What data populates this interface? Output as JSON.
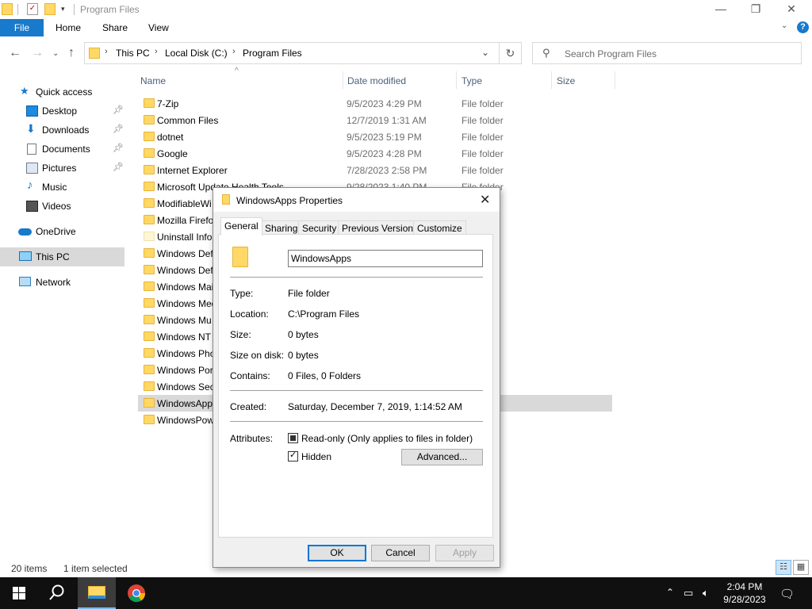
{
  "window": {
    "title": "Program Files",
    "minimize": "—",
    "maximize": "❐",
    "close": "✕"
  },
  "ribbon": {
    "file": "File",
    "tabs": [
      "Home",
      "Share",
      "View"
    ],
    "help": "?"
  },
  "address": {
    "crumbs": [
      "This PC",
      "Local Disk (C:)",
      "Program Files"
    ],
    "search_placeholder": "Search Program Files"
  },
  "nav": {
    "quick_access": "Quick access",
    "desktop": "Desktop",
    "downloads": "Downloads",
    "documents": "Documents",
    "pictures": "Pictures",
    "music": "Music",
    "videos": "Videos",
    "onedrive": "OneDrive",
    "this_pc": "This PC",
    "network": "Network"
  },
  "columns": {
    "name": "Name",
    "date": "Date modified",
    "type": "Type",
    "size": "Size"
  },
  "files": [
    {
      "name": "7-Zip",
      "date": "9/5/2023 4:29 PM",
      "type": "File folder"
    },
    {
      "name": "Common Files",
      "date": "12/7/2019 1:31 AM",
      "type": "File folder"
    },
    {
      "name": "dotnet",
      "date": "9/5/2023 5:19 PM",
      "type": "File folder"
    },
    {
      "name": "Google",
      "date": "9/5/2023 4:28 PM",
      "type": "File folder"
    },
    {
      "name": "Internet Explorer",
      "date": "7/28/2023 2:58 PM",
      "type": "File folder"
    },
    {
      "name": "Microsoft Update Health Tools",
      "date": "9/28/2023 1:40 PM",
      "type": "File folder"
    },
    {
      "name": "ModifiableWi",
      "date": "",
      "type": ""
    },
    {
      "name": "Mozilla Firefo",
      "date": "",
      "type": ""
    },
    {
      "name": "Uninstall Info",
      "date": "",
      "type": ""
    },
    {
      "name": "Windows Def",
      "date": "",
      "type": ""
    },
    {
      "name": "Windows Def",
      "date": "",
      "type": ""
    },
    {
      "name": "Windows Mai",
      "date": "",
      "type": ""
    },
    {
      "name": "Windows Med",
      "date": "",
      "type": ""
    },
    {
      "name": "Windows Mu",
      "date": "",
      "type": ""
    },
    {
      "name": "Windows NT",
      "date": "",
      "type": ""
    },
    {
      "name": "Windows Pho",
      "date": "",
      "type": ""
    },
    {
      "name": "Windows Por",
      "date": "",
      "type": ""
    },
    {
      "name": "Windows Sec",
      "date": "",
      "type": ""
    },
    {
      "name": "WindowsApp",
      "date": "",
      "type": ""
    },
    {
      "name": "WindowsPow",
      "date": "",
      "type": ""
    }
  ],
  "status": {
    "count": "20 items",
    "selected": "1 item selected"
  },
  "dialog": {
    "title": "WindowsApps Properties",
    "tabs": [
      "General",
      "Sharing",
      "Security",
      "Previous Versions",
      "Customize"
    ],
    "folder_name": "WindowsApps",
    "type_label": "Type:",
    "type_value": "File folder",
    "location_label": "Location:",
    "location_value": "C:\\Program Files",
    "size_label": "Size:",
    "size_value": "0 bytes",
    "size_on_disk_label": "Size on disk:",
    "size_on_disk_value": "0 bytes",
    "contains_label": "Contains:",
    "contains_value": "0 Files, 0 Folders",
    "created_label": "Created:",
    "created_value": "Saturday, December 7, 2019, 1:14:52 AM",
    "attributes_label": "Attributes:",
    "readonly_label": "Read-only (Only applies to files in folder)",
    "readonly_state": "indeterminate",
    "hidden_label": "Hidden",
    "hidden_state": "checked",
    "advanced": "Advanced...",
    "ok": "OK",
    "cancel": "Cancel",
    "apply": "Apply",
    "close": "✕"
  },
  "taskbar": {
    "time": "2:04 PM",
    "date": "9/28/2023"
  }
}
